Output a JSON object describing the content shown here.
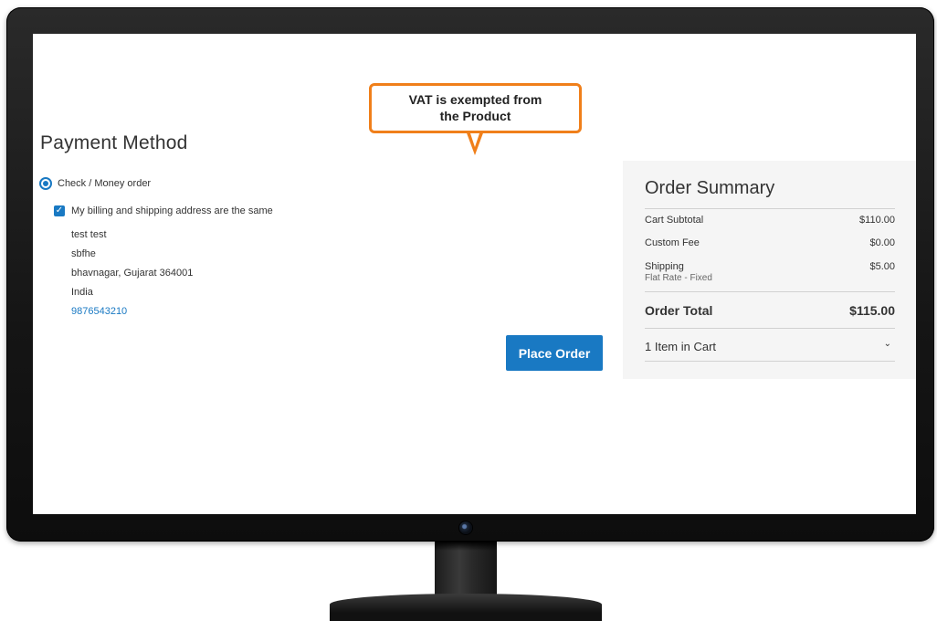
{
  "callout": {
    "line1": "VAT is exempted from",
    "line2": "the Product"
  },
  "payment": {
    "title": "Payment Method",
    "method_label": "Check / Money order",
    "same_address_label": "My billing and shipping address are the same",
    "address": {
      "name": "test test",
      "street": "sbfhe",
      "city_line": "bhavnagar, Gujarat 364001",
      "country": "India",
      "phone": "9876543210"
    },
    "place_order_label": "Place Order"
  },
  "summary": {
    "title": "Order Summary",
    "cart_subtotal_label": "Cart Subtotal",
    "cart_subtotal_value": "$110.00",
    "custom_fee_label": "Custom Fee",
    "custom_fee_value": "$0.00",
    "shipping_label": "Shipping",
    "shipping_method": "Flat Rate - Fixed",
    "shipping_value": "$5.00",
    "order_total_label": "Order Total",
    "order_total_value": "$115.00",
    "items_in_cart_label": "1 Item in Cart"
  },
  "colors": {
    "accent": "#1979c3",
    "callout_border": "#f07f1a",
    "summary_bg": "#f5f5f5"
  },
  "icons": {
    "radio": "radio-selected-icon",
    "checkbox": "checkbox-checked-icon",
    "expand": "chevron-down-icon"
  }
}
